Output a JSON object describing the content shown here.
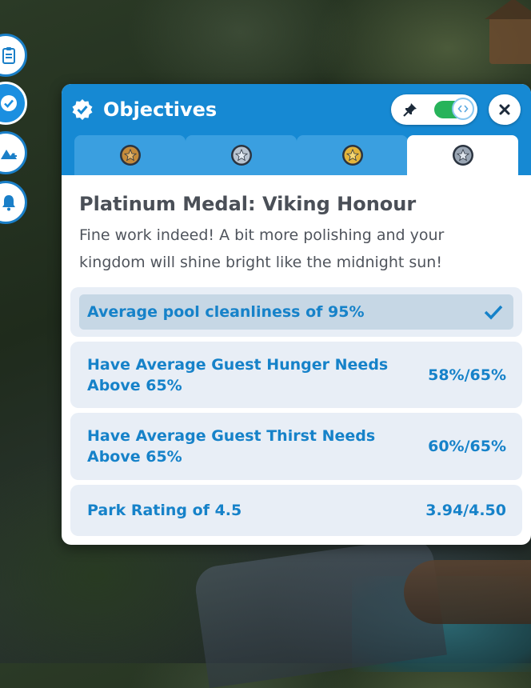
{
  "panel": {
    "title": "Objectives",
    "tabs": [
      {
        "name": "bronze-medal-tab",
        "color": "#c48a3a",
        "active": false
      },
      {
        "name": "silver-medal-tab",
        "color": "#b9c4d0",
        "active": false
      },
      {
        "name": "gold-medal-tab",
        "color": "#e3b43a",
        "active": false
      },
      {
        "name": "platinum-medal-tab",
        "color": "#9aa6b4",
        "active": true
      }
    ],
    "pin_toggle_on": true
  },
  "medal": {
    "title": "Platinum Medal: Viking Honour",
    "description": "Fine work indeed! A bit more polishing and your kingdom will shine bright like the midnight sun!"
  },
  "objectives": [
    {
      "label": "Average pool cleanliness of 95%",
      "progress": "",
      "completed": true
    },
    {
      "label": "Have Average Guest Hunger Needs Above 65%",
      "progress": "58%/65%",
      "completed": false
    },
    {
      "label": "Have Average Guest Thirst Needs Above 65%",
      "progress": "60%/65%",
      "completed": false
    },
    {
      "label": "Park Rating of 4.5",
      "progress": "3.94/4.50",
      "completed": false
    }
  ],
  "colors": {
    "header_blue": "#1689d3",
    "objective_text": "#1682c9",
    "toggle_green": "#27b35a"
  },
  "side_buttons": [
    {
      "icon": "clipboard-icon"
    },
    {
      "icon": "objectives-badge-icon",
      "active": true
    },
    {
      "icon": "add-terrain-icon"
    },
    {
      "icon": "bell-icon"
    }
  ]
}
